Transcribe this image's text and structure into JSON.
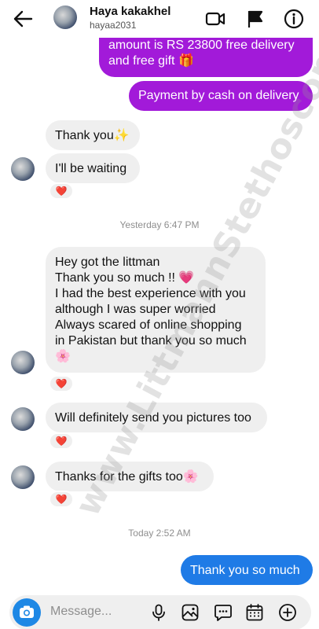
{
  "header": {
    "name": "Haya kakakhel",
    "handle": "hayaa2031"
  },
  "messages": {
    "out1_line1": "amount is RS 23800 free delivery",
    "out1_line2": "and free gift 🎁",
    "out2": "Payment by cash on delivery",
    "in1": "Thank you✨",
    "in2": "I'll be waiting",
    "stamp1": "Yesterday 6:47 PM",
    "in3_lines": [
      "Hey got the littman",
      "Thank you so much !! 💗",
      "I had the best experience with you",
      "although I was super worried",
      "Always scared of online shopping",
      "in Pakistan but thank you so much",
      "🌸"
    ],
    "in4": "Will definitely send you pictures too",
    "in5": "Thanks for the gifts too🌸",
    "stamp2": "Today 2:52 AM",
    "out3": "Thank you so much",
    "reaction": "❤️"
  },
  "watermark": "www.LittmannStethoscopes.PK",
  "composer": {
    "placeholder": "Message..."
  },
  "colors": {
    "outgoing_purple": "#a21ad9",
    "outgoing_blue": "#1f7be6",
    "incoming_gray": "#efefef",
    "camera_blue": "#1e88e5"
  },
  "icons": [
    "back-arrow-icon",
    "video-call-icon",
    "flag-icon",
    "info-icon",
    "camera-icon",
    "microphone-icon",
    "image-icon",
    "sticker-icon",
    "calendar-icon",
    "add-icon"
  ]
}
